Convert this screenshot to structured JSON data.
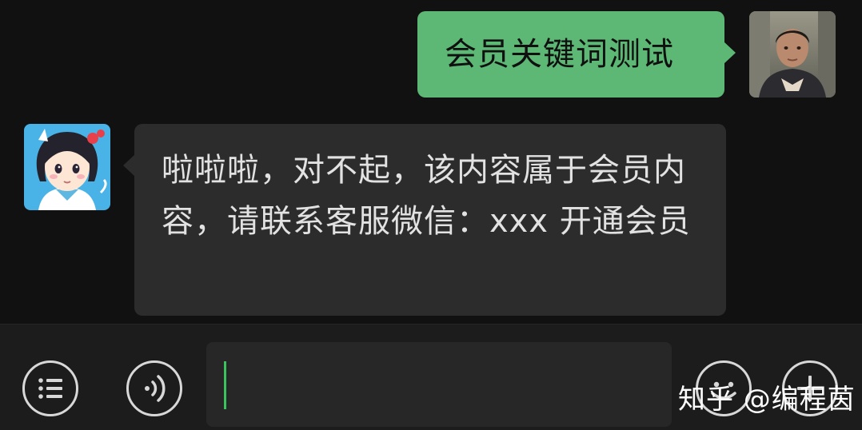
{
  "chat": {
    "messages": [
      {
        "sender": "user",
        "text": "会员关键词测试"
      },
      {
        "sender": "bot",
        "text": "啦啦啦，对不起，该内容属于会员内容，请联系客服微信：xxx 开通会员"
      }
    ]
  },
  "input_bar": {
    "value": "",
    "icons": {
      "menu": "list-menu-icon",
      "voice": "voice-icon",
      "emoji": "emoji-icon",
      "plus": "plus-icon"
    }
  },
  "watermark": "知乎 @编程茵",
  "colors": {
    "background": "#111111",
    "sent_bubble": "#5cb874",
    "received_bubble": "#2c2c2c",
    "caret": "#39c45c"
  }
}
